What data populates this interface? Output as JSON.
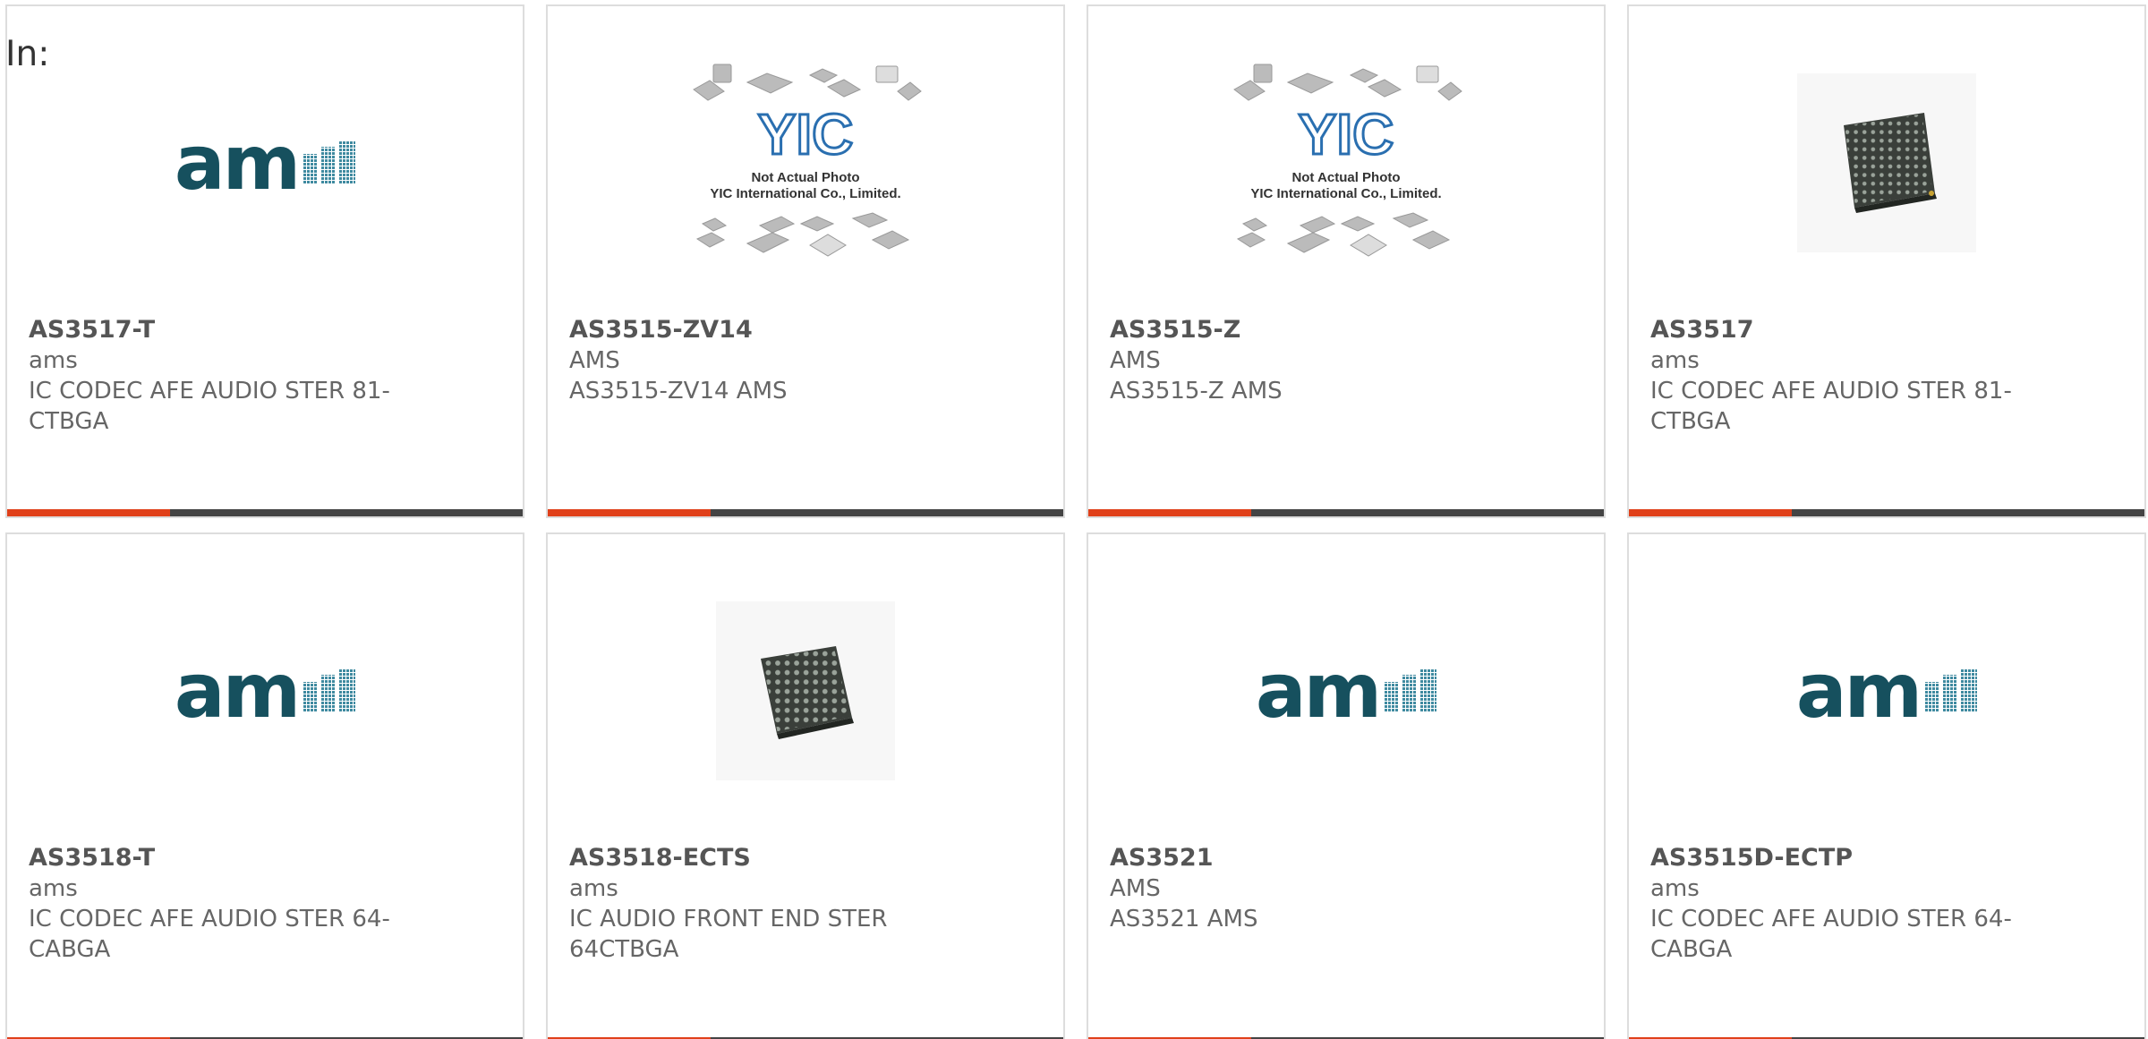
{
  "header": {
    "in_label": "In:"
  },
  "colors": {
    "accent": "#e0401a",
    "bar": "#444444",
    "border": "#dddddd",
    "logo": "#16505e"
  },
  "placeholder": {
    "line1": "Not Actual Photo",
    "line2": "YIC International Co., Limited.",
    "logo_text": "YIC"
  },
  "logo": {
    "ams_word": "am"
  },
  "products": [
    {
      "part": "AS3517-T",
      "mfr": "ams",
      "desc": "IC CODEC AFE AUDIO STER 81-CTBGA",
      "image": "ams-logo"
    },
    {
      "part": "AS3515-ZV14",
      "mfr": "AMS",
      "desc": "AS3515-ZV14 AMS",
      "image": "yic-placeholder"
    },
    {
      "part": "AS3515-Z",
      "mfr": "AMS",
      "desc": "AS3515-Z AMS",
      "image": "yic-placeholder"
    },
    {
      "part": "AS3517",
      "mfr": "ams",
      "desc": "IC CODEC AFE AUDIO STER 81-CTBGA",
      "image": "bga-chip"
    },
    {
      "part": "AS3518-T",
      "mfr": "ams",
      "desc": "IC CODEC AFE AUDIO STER 64-CABGA",
      "image": "ams-logo"
    },
    {
      "part": "AS3518-ECTS",
      "mfr": "ams",
      "desc": "IC AUDIO FRONT END STER 64CTBGA",
      "image": "bga-chip"
    },
    {
      "part": "AS3521",
      "mfr": "AMS",
      "desc": "AS3521 AMS",
      "image": "ams-logo"
    },
    {
      "part": "AS3515D-ECTP",
      "mfr": "ams",
      "desc": "IC CODEC AFE AUDIO STER 64-CABGA",
      "image": "ams-logo"
    }
  ]
}
